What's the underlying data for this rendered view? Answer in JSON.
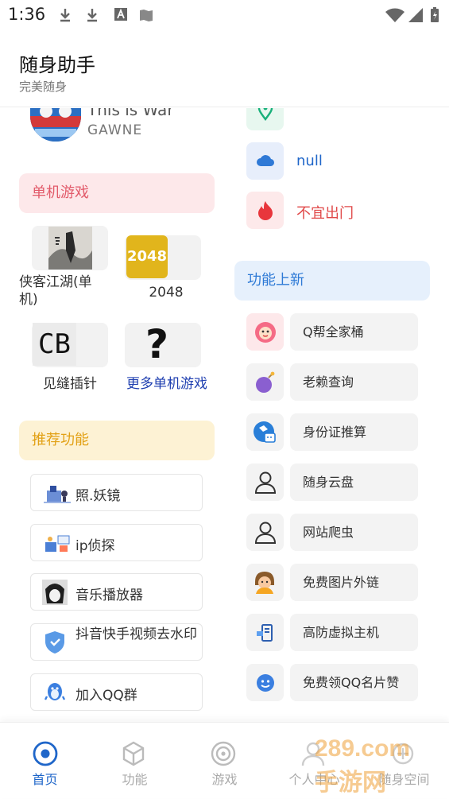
{
  "status_bar": {
    "time": "1:36"
  },
  "header": {
    "title": "随身助手",
    "subtitle": "完美随身"
  },
  "music": {
    "song": "This is War",
    "artist": "GAWNE"
  },
  "weather": {
    "city": "null",
    "advice": "不宜出门"
  },
  "colors": {
    "accent_blue": "#1f66c9",
    "advice_red": "#e04848",
    "section_pink": "#fde8ea",
    "section_yellow": "#fdf2d4",
    "section_blue": "#e6f0fc",
    "nav_active": "#1f66c9"
  },
  "single_games": {
    "title": "单机游戏",
    "items": [
      {
        "label": "侠客江湖(单机)",
        "icon": "wuxia-game-icon"
      },
      {
        "label": "2048",
        "icon": "2048-game-icon"
      },
      {
        "label": "见缝插针",
        "icon": "cb-game-icon"
      },
      {
        "label": "更多单机游戏",
        "icon": "question-icon"
      }
    ]
  },
  "recommended": {
    "title": "推荐功能",
    "items": [
      {
        "label": "照.妖镜",
        "icon": "camera-scene-icon"
      },
      {
        "label": "ip侦探",
        "icon": "ip-scene-icon"
      },
      {
        "label": "音乐播放器",
        "icon": "anime-avatar-icon"
      },
      {
        "label": "抖音快手视频去水印",
        "icon": "shield-icon"
      },
      {
        "label": "加入QQ群",
        "icon": "qq-penguin-icon"
      }
    ]
  },
  "new_features": {
    "title": "功能上新",
    "items": [
      {
        "label": "Q帮全家桶",
        "icon": "pink-lion-icon"
      },
      {
        "label": "老赖查询",
        "icon": "purple-bomb-icon"
      },
      {
        "label": "身份证推算",
        "icon": "id-card-icon"
      },
      {
        "label": "随身云盘",
        "icon": "user-outline-icon"
      },
      {
        "label": "网站爬虫",
        "icon": "user-outline-icon"
      },
      {
        "label": "免费图片外链",
        "icon": "person-avatar-icon"
      },
      {
        "label": "高防虚拟主机",
        "icon": "server-icon"
      },
      {
        "label": "免费领QQ名片赞",
        "icon": "qq-face-icon"
      }
    ]
  },
  "nav": {
    "items": [
      {
        "label": "首页",
        "icon": "home-target-icon",
        "active": true
      },
      {
        "label": "功能",
        "icon": "cube-icon",
        "active": false
      },
      {
        "label": "游戏",
        "icon": "swirl-icon",
        "active": false
      },
      {
        "label": "个人中心",
        "icon": "person-icon",
        "active": false
      },
      {
        "label": "随身空间",
        "icon": "space-icon",
        "active": false
      }
    ]
  },
  "watermark": "289.com 手游网"
}
